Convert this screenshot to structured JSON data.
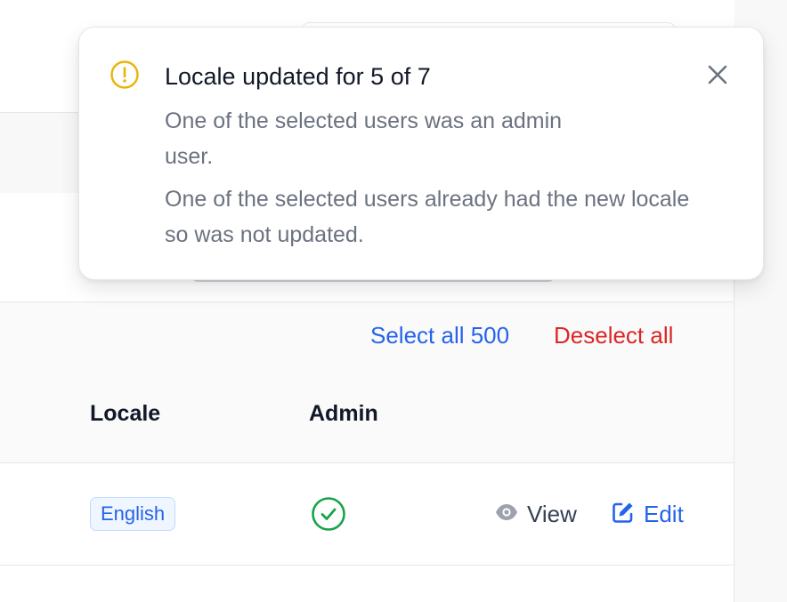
{
  "notification": {
    "title": "Locale updated for 5 of 7",
    "messages": [
      "One of the selected users was an admin user.",
      "One of the selected users already had the new locale so was not updated."
    ],
    "icon": "warning-circle-icon",
    "close_icon": "close-icon",
    "icon_color": "#eab308"
  },
  "selection": {
    "select_all_label": "Select all 500",
    "deselect_all_label": "Deselect all",
    "select_color": "#2563eb",
    "deselect_color": "#dc2626"
  },
  "table": {
    "columns": [
      "Locale",
      "Admin"
    ],
    "rows": [
      {
        "locale": "English",
        "admin": true,
        "view_label": "View",
        "edit_label": "Edit"
      }
    ]
  },
  "colors": {
    "accent": "#2563eb",
    "success": "#16a34a",
    "danger": "#dc2626"
  }
}
